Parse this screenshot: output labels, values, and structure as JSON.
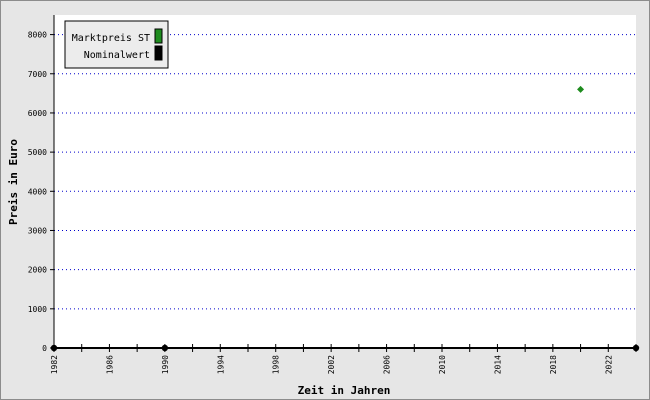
{
  "chart_data": {
    "type": "scatter",
    "xlabel": "Zeit in Jahren",
    "ylabel": "Preis in Euro",
    "xlim": [
      1982,
      2024
    ],
    "ylim": [
      0,
      8500
    ],
    "x_ticks": [
      1982,
      1986,
      1990,
      1994,
      1998,
      2002,
      2006,
      2010,
      2014,
      2018,
      2022
    ],
    "y_ticks": [
      0,
      1000,
      2000,
      3000,
      4000,
      5000,
      6000,
      7000,
      8000
    ],
    "grid": "horizontal dotted",
    "legend_placement": "top-left",
    "series": [
      {
        "name": "Marktpreis ST",
        "color": "#1e8c1e",
        "marker": "diamond",
        "points": [
          [
            2020,
            6600
          ]
        ]
      },
      {
        "name": "Nominalwert",
        "color": "#000000",
        "marker": "circle",
        "points": [
          [
            1982,
            0
          ],
          [
            1990,
            0
          ],
          [
            2024,
            0
          ]
        ]
      }
    ]
  }
}
